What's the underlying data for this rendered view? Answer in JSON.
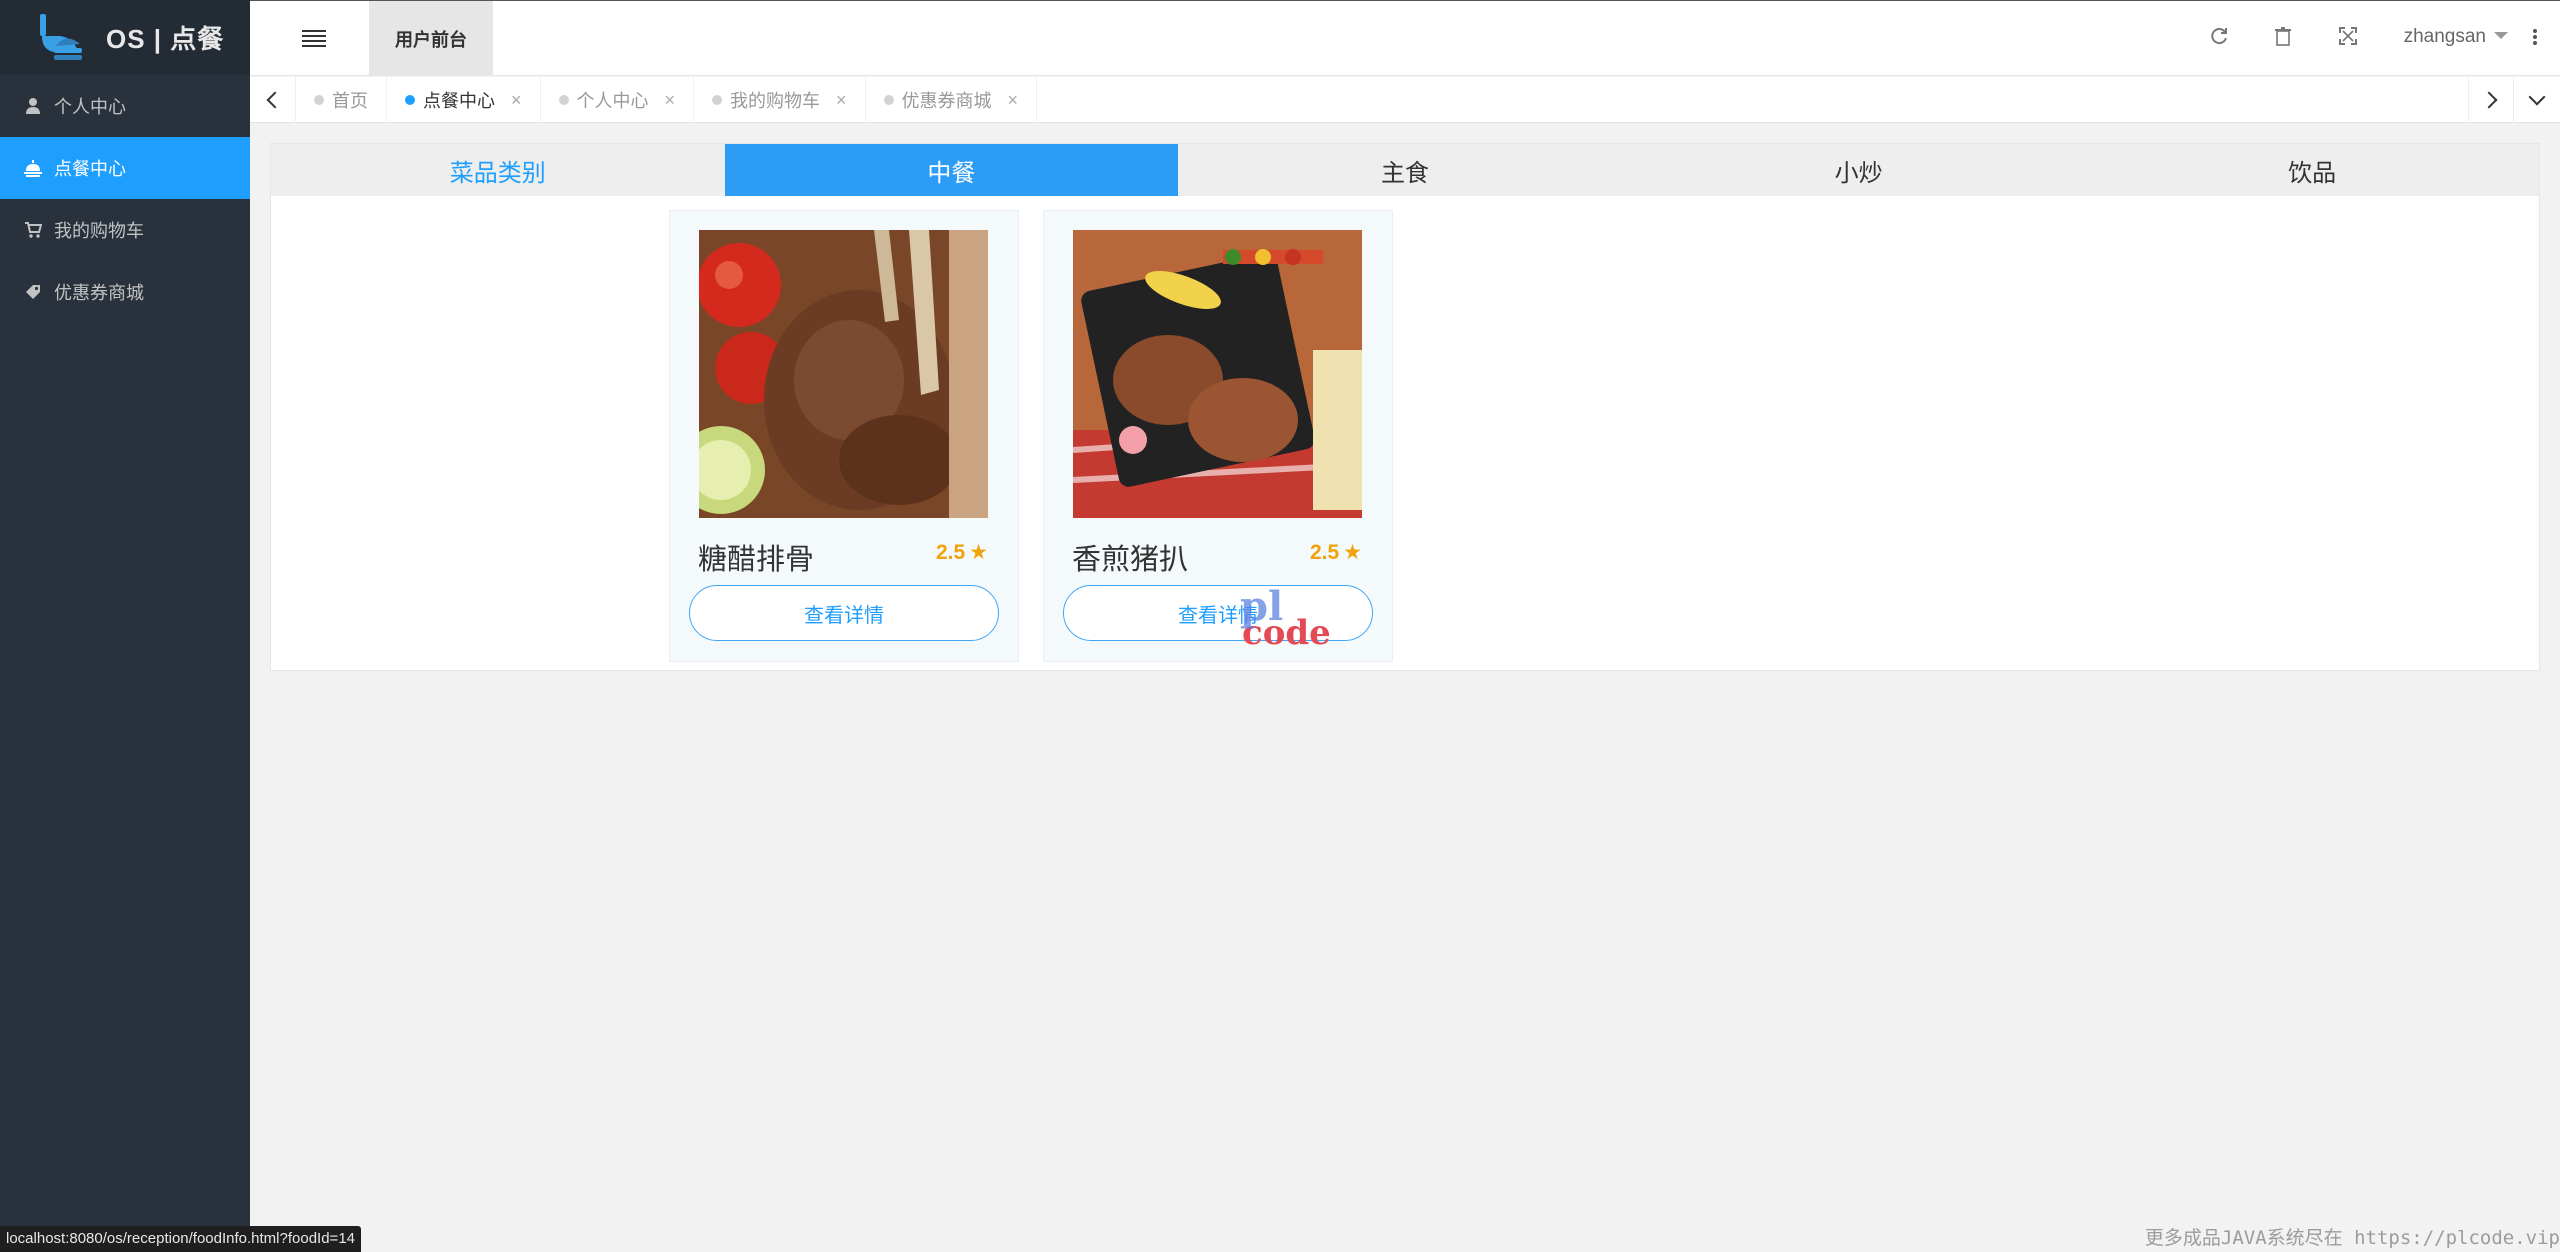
{
  "app": {
    "title": "OS | 点餐"
  },
  "sidebar": {
    "items": [
      {
        "label": "个人中心",
        "icon": "user-icon",
        "active": false
      },
      {
        "label": "点餐中心",
        "icon": "food-tray-icon",
        "active": true
      },
      {
        "label": "我的购物车",
        "icon": "cart-icon",
        "active": false
      },
      {
        "label": "优惠券商城",
        "icon": "tag-icon",
        "active": false
      }
    ]
  },
  "header": {
    "title": "用户前台",
    "user": "zhangsan"
  },
  "tabs": [
    {
      "label": "首页",
      "closable": false,
      "active": false
    },
    {
      "label": "点餐中心",
      "closable": true,
      "active": true
    },
    {
      "label": "个人中心",
      "closable": true,
      "active": false
    },
    {
      "label": "我的购物车",
      "closable": true,
      "active": false
    },
    {
      "label": "优惠券商城",
      "closable": true,
      "active": false
    }
  ],
  "categories": {
    "heading": "菜品类别",
    "items": [
      "中餐",
      "主食",
      "小炒",
      "饮品"
    ],
    "selected": "中餐"
  },
  "foods": [
    {
      "name": "糖醋排骨",
      "rating": "2.5",
      "button": "查看详情"
    },
    {
      "name": "香煎猪扒",
      "rating": "2.5",
      "button": "查看详情"
    }
  ],
  "watermark": {
    "line1": "pl",
    "line2": "code"
  },
  "status_url": "localhost:8080/os/reception/foodInfo.html?foodId=14",
  "footer": "更多成品JAVA系统尽在 https://plcode.vip",
  "colors": {
    "sidebar": "#28313c",
    "accent": "#1e9fff",
    "rating": "#f0a30a"
  }
}
